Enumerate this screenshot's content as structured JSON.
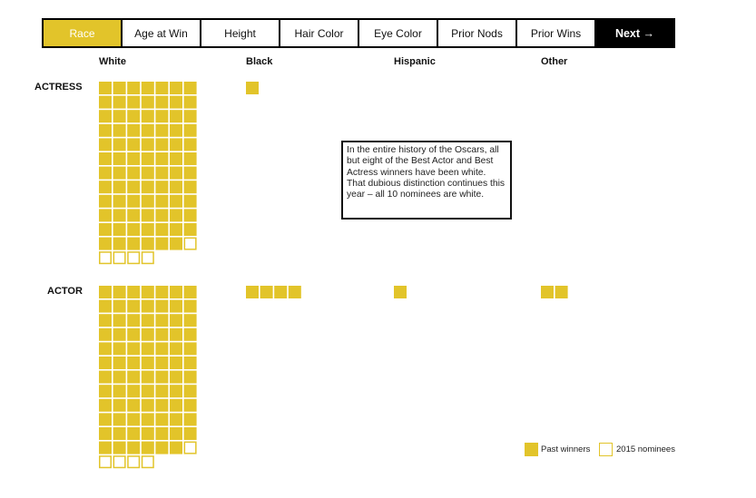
{
  "tabs": [
    {
      "label": "Race",
      "active": true
    },
    {
      "label": "Age at Win",
      "active": false
    },
    {
      "label": "Height",
      "active": false
    },
    {
      "label": "Hair Color",
      "active": false
    },
    {
      "label": "Eye Color",
      "active": false
    },
    {
      "label": "Prior Nods",
      "active": false
    },
    {
      "label": "Prior Wins",
      "active": false
    }
  ],
  "next_label": "Next →",
  "tooltip": "In the entire history of the Oscars, all but eight of the Best Actor and Best Actress winners have been white. That dubious distinction continues this year – all 10 nominees are white.",
  "colors": {
    "accent": "#e2c42a",
    "border": "#111111"
  },
  "legend": {
    "past": "Past winners",
    "nominees": "2015 nominees"
  },
  "chart_data": {
    "type": "unit-grid",
    "categories": [
      "White",
      "Black",
      "Hispanic",
      "Other"
    ],
    "rows": [
      {
        "label": "ACTRESS",
        "past_winners": [
          83,
          1,
          0,
          0
        ],
        "nominees_2015": [
          5,
          0,
          0,
          0
        ]
      },
      {
        "label": "ACTOR",
        "past_winners": [
          83,
          4,
          1,
          2
        ],
        "nominees_2015": [
          5,
          0,
          0,
          0
        ]
      }
    ],
    "units_per_row": 7
  }
}
